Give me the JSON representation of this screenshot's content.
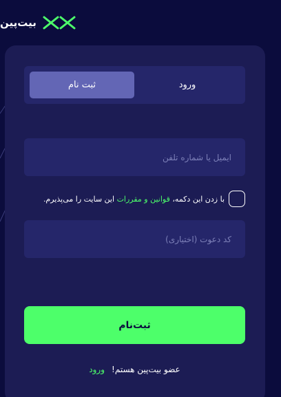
{
  "header": {
    "brand_name": "بیت‌پین",
    "logo_icon": "bitpin-x-logo-icon"
  },
  "tabs": [
    {
      "label": "ورود",
      "active": false
    },
    {
      "label": "ثبت نام",
      "active": true
    }
  ],
  "form": {
    "phone_placeholder": "ایمیل یا شماره تلفن",
    "phone_value": "",
    "invite_placeholder": "کد دعوت (اختیاری)",
    "invite_value": "",
    "terms_prefix": "با زدن این دکمه،",
    "terms_link": "قوانین و مقررات",
    "terms_suffix": "این سایت را می‌پذیرم.",
    "terms_checked": false,
    "submit_label": "ثبت‌نام"
  },
  "footer": {
    "text": "عضو بیت‌پین هستم!",
    "link": "ورود"
  },
  "colors": {
    "background": "#0b0c3d",
    "card": "#1c1c54",
    "field": "#25266a",
    "active_tab": "#6366b5",
    "accent": "#4dff6a"
  }
}
